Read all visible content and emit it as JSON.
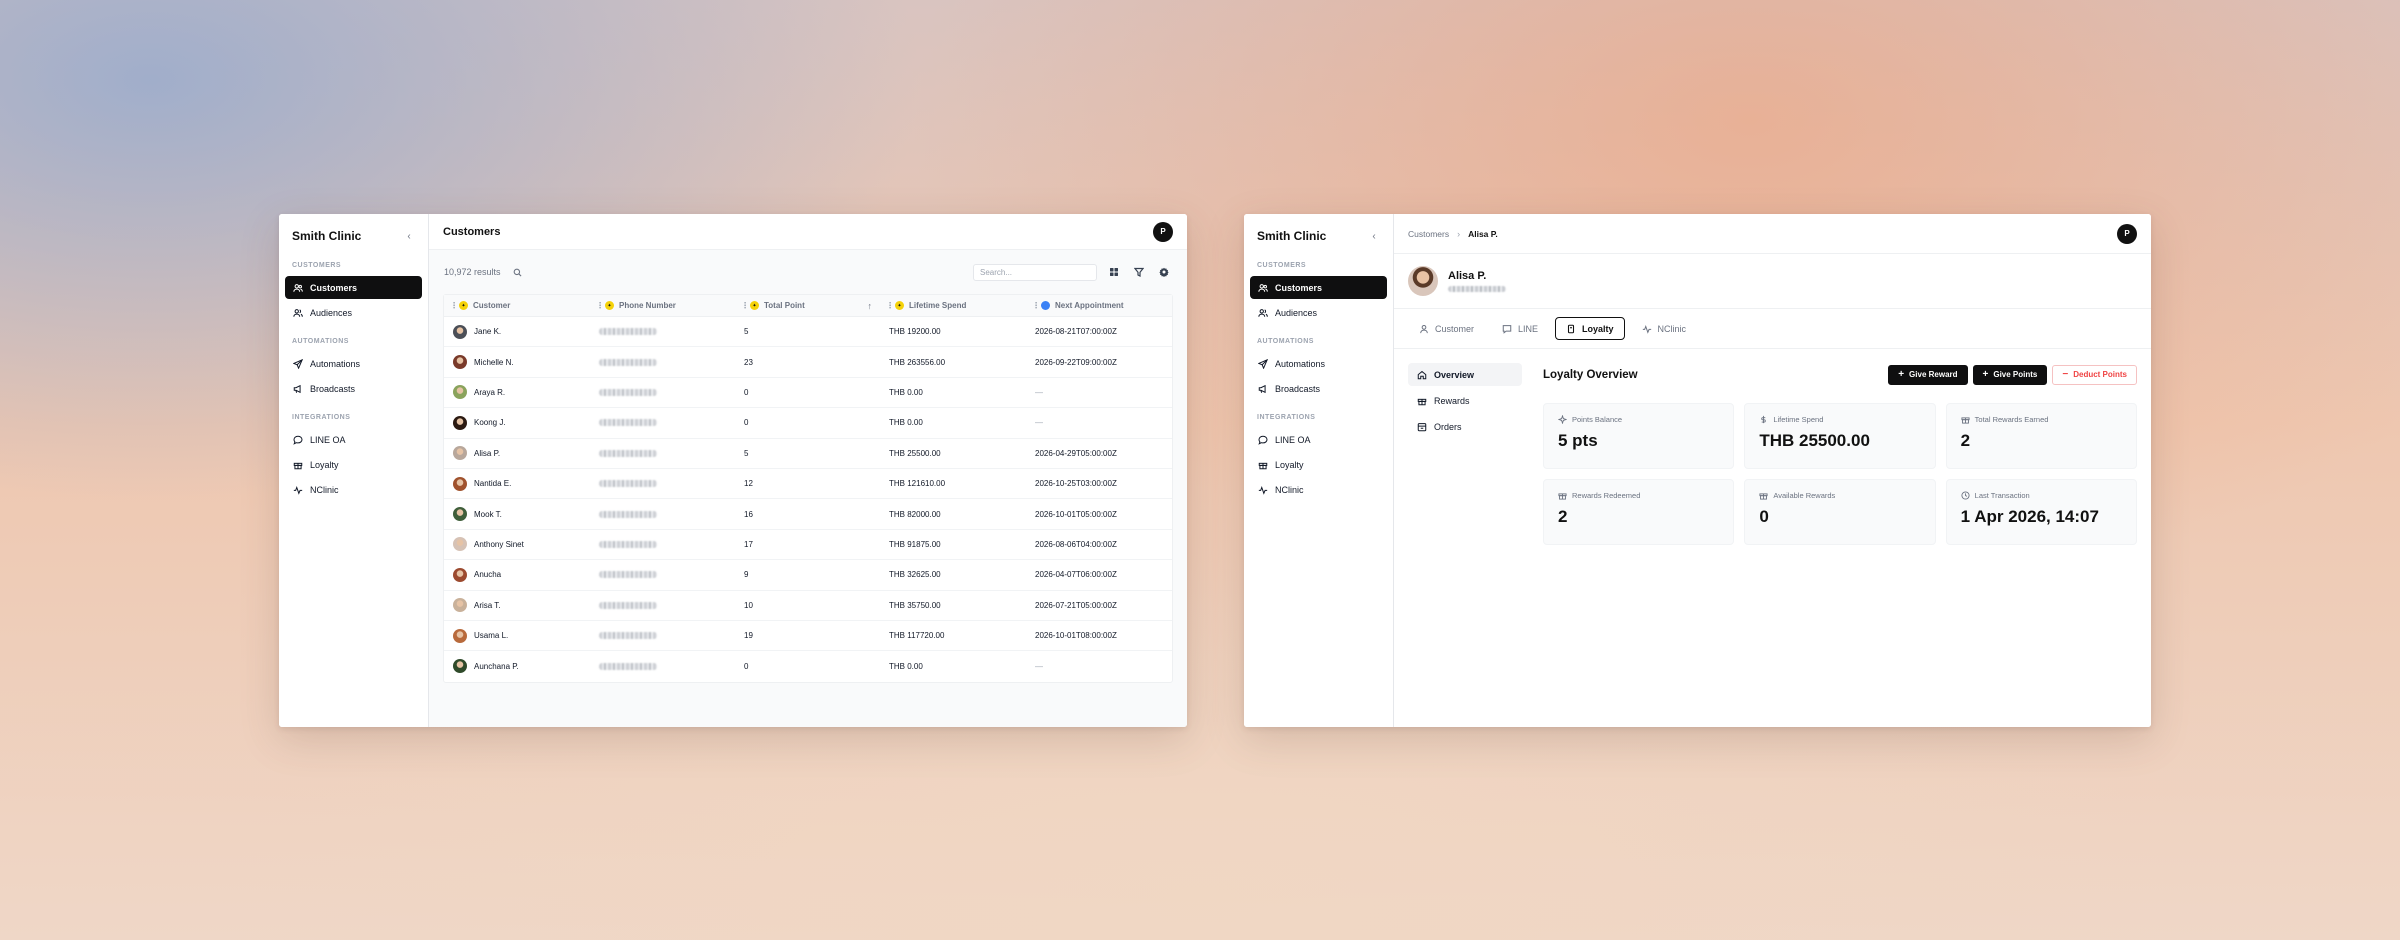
{
  "left_window": {
    "sidebar": {
      "title": "Smith Clinic",
      "collapse_icon": "chevron-left-icon",
      "sections": [
        {
          "label": "CUSTOMERS",
          "items": [
            {
              "label": "Customers",
              "icon": "users-icon",
              "active": true
            },
            {
              "label": "Audiences",
              "icon": "audience-icon",
              "active": false
            }
          ]
        },
        {
          "label": "AUTOMATIONS",
          "items": [
            {
              "label": "Automations",
              "icon": "send-icon",
              "active": false
            },
            {
              "label": "Broadcasts",
              "icon": "megaphone-icon",
              "active": false
            }
          ]
        },
        {
          "label": "INTEGRATIONS",
          "items": [
            {
              "label": "LINE OA",
              "icon": "chat-icon",
              "active": false
            },
            {
              "label": "Loyalty",
              "icon": "gift-icon",
              "active": false
            },
            {
              "label": "NClinic",
              "icon": "pulse-icon",
              "active": false
            }
          ]
        }
      ]
    },
    "header": {
      "title": "Customers",
      "avatar_initial": "P"
    },
    "toolbar": {
      "results": "10,972 results",
      "search_placeholder": "Search...",
      "tool_icons": [
        "grid-icon",
        "filter-icon",
        "settings-icon"
      ]
    },
    "table": {
      "columns": [
        {
          "label": "Customer",
          "badge": "yellow"
        },
        {
          "label": "Phone Number",
          "badge": "yellow"
        },
        {
          "label": "Total Point",
          "badge": "yellow",
          "sort": "up"
        },
        {
          "label": "Lifetime Spend",
          "badge": "yellow"
        },
        {
          "label": "Next Appointment",
          "badge": "blue"
        }
      ],
      "rows": [
        {
          "name": "Jane K.",
          "points": "5",
          "spend": "THB 19200.00",
          "next": "2026-08-21T07:00:00Z",
          "avatar_color": "#4b4f57"
        },
        {
          "name": "Michelle N.",
          "points": "23",
          "spend": "THB 263556.00",
          "next": "2026-09-22T09:00:00Z",
          "avatar_color": "#7a3a2a"
        },
        {
          "name": "Araya R.",
          "points": "0",
          "spend": "THB 0.00",
          "next": "—",
          "avatar_color": "#8aa35c"
        },
        {
          "name": "Koong J.",
          "points": "0",
          "spend": "THB 0.00",
          "next": "—",
          "avatar_color": "#2b1a12"
        },
        {
          "name": "Alisa P.",
          "points": "5",
          "spend": "THB 25500.00",
          "next": "2026-04-29T05:00:00Z",
          "avatar_color": "#b8a79b"
        },
        {
          "name": "Nantida E.",
          "points": "12",
          "spend": "THB 121610.00",
          "next": "2026-10-25T03:00:00Z",
          "avatar_color": "#a0522d"
        },
        {
          "name": "Mook T.",
          "points": "16",
          "spend": "THB 82000.00",
          "next": "2026-10-01T05:00:00Z",
          "avatar_color": "#3f5e3a"
        },
        {
          "name": "Anthony Sinet",
          "points": "17",
          "spend": "THB 91875.00",
          "next": "2026-08-06T04:00:00Z",
          "avatar_color": "#d6c2b5"
        },
        {
          "name": "Anucha",
          "points": "9",
          "spend": "THB 32625.00",
          "next": "2026-04-07T06:00:00Z",
          "avatar_color": "#9c4a2f"
        },
        {
          "name": "Arisa T.",
          "points": "10",
          "spend": "THB 35750.00",
          "next": "2026-07-21T05:00:00Z",
          "avatar_color": "#c9b19a"
        },
        {
          "name": "Usama L.",
          "points": "19",
          "spend": "THB 117720.00",
          "next": "2026-10-01T08:00:00Z",
          "avatar_color": "#b86a3c"
        },
        {
          "name": "Aunchana P.",
          "points": "0",
          "spend": "THB 0.00",
          "next": "—",
          "avatar_color": "#2f4a2a"
        }
      ]
    }
  },
  "right_window": {
    "sidebar": {
      "title": "Smith Clinic",
      "collapse_icon": "chevron-left-icon",
      "sections": [
        {
          "label": "CUSTOMERS",
          "items": [
            {
              "label": "Customers",
              "icon": "users-icon",
              "active": true
            },
            {
              "label": "Audiences",
              "icon": "audience-icon",
              "active": false
            }
          ]
        },
        {
          "label": "AUTOMATIONS",
          "items": [
            {
              "label": "Automations",
              "icon": "send-icon",
              "active": false
            },
            {
              "label": "Broadcasts",
              "icon": "megaphone-icon",
              "active": false
            }
          ]
        },
        {
          "label": "INTEGRATIONS",
          "items": [
            {
              "label": "LINE OA",
              "icon": "chat-icon",
              "active": false
            },
            {
              "label": "Loyalty",
              "icon": "gift-icon",
              "active": false
            },
            {
              "label": "NClinic",
              "icon": "pulse-icon",
              "active": false
            }
          ]
        }
      ]
    },
    "breadcrumb": {
      "parent": "Customers",
      "current": "Alisa P.",
      "avatar_initial": "P"
    },
    "profile": {
      "name": "Alisa P."
    },
    "tabs": [
      {
        "label": "Customer",
        "icon": "user-icon",
        "active": false
      },
      {
        "label": "LINE",
        "icon": "chat-icon",
        "active": false
      },
      {
        "label": "Loyalty",
        "icon": "badge-icon",
        "active": true
      },
      {
        "label": "NClinic",
        "icon": "pulse-icon",
        "active": false
      }
    ],
    "subnav": [
      {
        "label": "Overview",
        "icon": "home-icon",
        "active": true
      },
      {
        "label": "Rewards",
        "icon": "gift-icon",
        "active": false
      },
      {
        "label": "Orders",
        "icon": "box-icon",
        "active": false
      }
    ],
    "overview": {
      "title": "Loyalty Overview",
      "actions": {
        "give_reward": "Give Reward",
        "give_points": "Give Points",
        "deduct_points": "Deduct Points"
      },
      "stats": [
        {
          "label": "Points Balance",
          "value": "5 pts",
          "icon": "sparkle-icon"
        },
        {
          "label": "Lifetime Spend",
          "value": "THB 25500.00",
          "icon": "dollar-icon"
        },
        {
          "label": "Total Rewards Earned",
          "value": "2",
          "icon": "gift-icon"
        },
        {
          "label": "Rewards Redeemed",
          "value": "2",
          "icon": "gift-icon"
        },
        {
          "label": "Available Rewards",
          "value": "0",
          "icon": "gift-icon"
        },
        {
          "label": "Last Transaction",
          "value": "1 Apr 2026, 14:07",
          "icon": "clock-icon"
        }
      ]
    }
  }
}
